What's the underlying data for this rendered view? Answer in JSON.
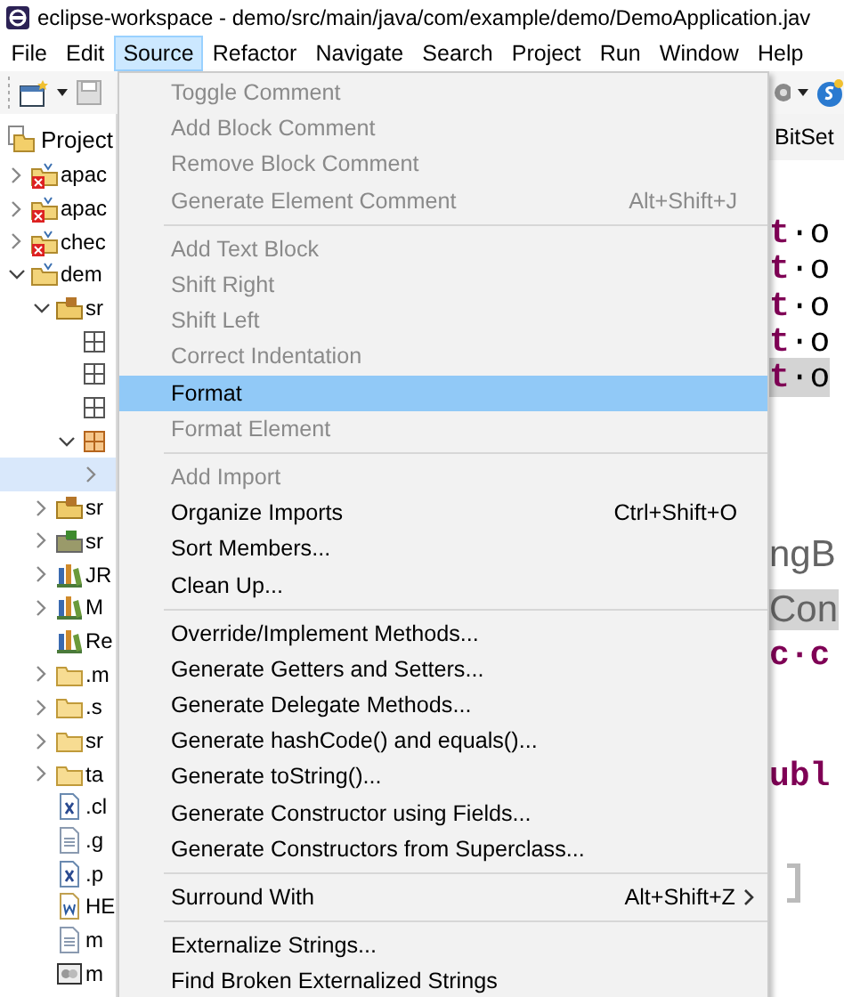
{
  "window": {
    "title": "eclipse-workspace - demo/src/main/java/com/example/demo/DemoApplication.jav"
  },
  "menubar": [
    {
      "label": "File",
      "selected": false
    },
    {
      "label": "Edit",
      "selected": false
    },
    {
      "label": "Source",
      "selected": true
    },
    {
      "label": "Refactor",
      "selected": false
    },
    {
      "label": "Navigate",
      "selected": false
    },
    {
      "label": "Search",
      "selected": false
    },
    {
      "label": "Project",
      "selected": false
    },
    {
      "label": "Run",
      "selected": false
    },
    {
      "label": "Window",
      "selected": false
    },
    {
      "label": "Help",
      "selected": false
    }
  ],
  "sidebar": {
    "title": "Project",
    "items": [
      {
        "label": "apac",
        "kind": "broken-project",
        "expanded": false,
        "selected": false
      },
      {
        "label": "apac",
        "kind": "broken-project",
        "expanded": false,
        "selected": false
      },
      {
        "label": "chec",
        "kind": "broken-project",
        "expanded": false,
        "selected": false
      },
      {
        "label": "dem",
        "kind": "project",
        "expanded": true,
        "selected": false,
        "children": [
          {
            "label": "sr",
            "kind": "source",
            "expanded": true,
            "selected": false,
            "children": [
              {
                "kind": "package",
                "selected": false
              },
              {
                "kind": "package",
                "selected": false
              },
              {
                "kind": "package",
                "selected": false
              },
              {
                "kind": "package-open",
                "expanded": true,
                "selected": false,
                "children": [
                  {
                    "expanded": false,
                    "selected": true
                  }
                ]
              }
            ]
          },
          {
            "label": "sr",
            "kind": "source",
            "expanded": false,
            "selected": false
          },
          {
            "label": "sr",
            "kind": "source-test",
            "expanded": false,
            "selected": false
          },
          {
            "label": "JR",
            "kind": "library",
            "expanded": false,
            "selected": false
          },
          {
            "label": "M",
            "kind": "library",
            "expanded": false,
            "selected": false
          },
          {
            "label": "Re",
            "kind": "library",
            "selected": false
          },
          {
            "label": ".m",
            "kind": "folder",
            "expanded": false,
            "selected": false
          },
          {
            "label": ".s",
            "kind": "folder",
            "expanded": false,
            "selected": false
          },
          {
            "label": "sr",
            "kind": "folder",
            "expanded": false,
            "selected": false
          },
          {
            "label": "ta",
            "kind": "folder",
            "expanded": false,
            "selected": false
          },
          {
            "label": ".cl",
            "kind": "xml",
            "selected": false
          },
          {
            "label": ".g",
            "kind": "text",
            "selected": false
          },
          {
            "label": ".p",
            "kind": "xml",
            "selected": false
          },
          {
            "label": "HE",
            "kind": "doc",
            "selected": false
          },
          {
            "label": "m",
            "kind": "text",
            "selected": false
          },
          {
            "label": "m",
            "kind": "image",
            "selected": false
          }
        ]
      }
    ]
  },
  "editor": {
    "tab": "BitSet",
    "blocks": [
      [
        {
          "text": "**t**·o",
          "kind": "code",
          "highlighted": false
        },
        {
          "text": "**t**·o",
          "kind": "code",
          "highlighted": false
        },
        {
          "text": "**t**·o",
          "kind": "code",
          "highlighted": false
        },
        {
          "text": "**t**·o",
          "kind": "code",
          "highlighted": false
        },
        {
          "text": "**t**·o",
          "kind": "code",
          "highlighted": true
        }
      ],
      [
        {
          "text": "ngB",
          "kind": "annotation",
          "highlighted": false
        },
        {
          "text": "Con",
          "kind": "annotation",
          "highlighted": true
        },
        {
          "text": "c·c",
          "kind": "keyword",
          "highlighted": false
        }
      ],
      [
        {
          "text": "ubl",
          "kind": "keyword",
          "highlighted": false
        }
      ]
    ]
  },
  "menu": {
    "items": [
      {
        "kind": "item",
        "label": "Toggle Comment",
        "disabled": true,
        "selected": false,
        "submenu": false
      },
      {
        "kind": "item",
        "label": "Add Block Comment",
        "disabled": true,
        "selected": false,
        "submenu": false
      },
      {
        "kind": "item",
        "label": "Remove Block Comment",
        "disabled": true,
        "selected": false,
        "submenu": false
      },
      {
        "kind": "item",
        "label": "Generate Element Comment",
        "shortcut": "Alt+Shift+J",
        "disabled": true,
        "selected": false,
        "submenu": false
      },
      {
        "kind": "separator"
      },
      {
        "kind": "item",
        "label": "Add Text Block",
        "disabled": true,
        "selected": false,
        "submenu": false
      },
      {
        "kind": "item",
        "label": "Shift Right",
        "disabled": true,
        "selected": false,
        "submenu": false
      },
      {
        "kind": "item",
        "label": "Shift Left",
        "disabled": true,
        "selected": false,
        "submenu": false
      },
      {
        "kind": "item",
        "label": "Correct Indentation",
        "disabled": true,
        "selected": false,
        "submenu": false
      },
      {
        "kind": "item",
        "label": "Format",
        "disabled": false,
        "selected": true,
        "submenu": false
      },
      {
        "kind": "item",
        "label": "Format Element",
        "disabled": true,
        "selected": false,
        "submenu": false
      },
      {
        "kind": "separator"
      },
      {
        "kind": "item",
        "label": "Add Import",
        "disabled": true,
        "selected": false,
        "submenu": false
      },
      {
        "kind": "item",
        "label": "Organize Imports",
        "shortcut": "Ctrl+Shift+O",
        "disabled": false,
        "selected": false,
        "submenu": false
      },
      {
        "kind": "item",
        "label": "Sort Members...",
        "disabled": false,
        "selected": false,
        "submenu": false
      },
      {
        "kind": "item",
        "label": "Clean Up...",
        "disabled": false,
        "selected": false,
        "submenu": false
      },
      {
        "kind": "separator"
      },
      {
        "kind": "item",
        "label": "Override/Implement Methods...",
        "disabled": false,
        "selected": false,
        "submenu": false
      },
      {
        "kind": "item",
        "label": "Generate Getters and Setters...",
        "disabled": false,
        "selected": false,
        "submenu": false
      },
      {
        "kind": "item",
        "label": "Generate Delegate Methods...",
        "disabled": false,
        "selected": false,
        "submenu": false
      },
      {
        "kind": "item",
        "label": "Generate hashCode() and equals()...",
        "disabled": false,
        "selected": false,
        "submenu": false
      },
      {
        "kind": "item",
        "label": "Generate toString()...",
        "disabled": false,
        "selected": false,
        "submenu": false
      },
      {
        "kind": "item",
        "label": "Generate Constructor using Fields...",
        "disabled": false,
        "selected": false,
        "submenu": false
      },
      {
        "kind": "item",
        "label": "Generate Constructors from Superclass...",
        "disabled": false,
        "selected": false,
        "submenu": false
      },
      {
        "kind": "separator"
      },
      {
        "kind": "item",
        "label": "Surround With",
        "shortcut": "Alt+Shift+Z",
        "disabled": false,
        "selected": false,
        "submenu": true
      },
      {
        "kind": "separator"
      },
      {
        "kind": "item",
        "label": "Externalize Strings...",
        "disabled": false,
        "selected": false,
        "submenu": false
      },
      {
        "kind": "item",
        "label": "Find Broken Externalized Strings",
        "disabled": false,
        "selected": false,
        "submenu": false
      }
    ]
  }
}
